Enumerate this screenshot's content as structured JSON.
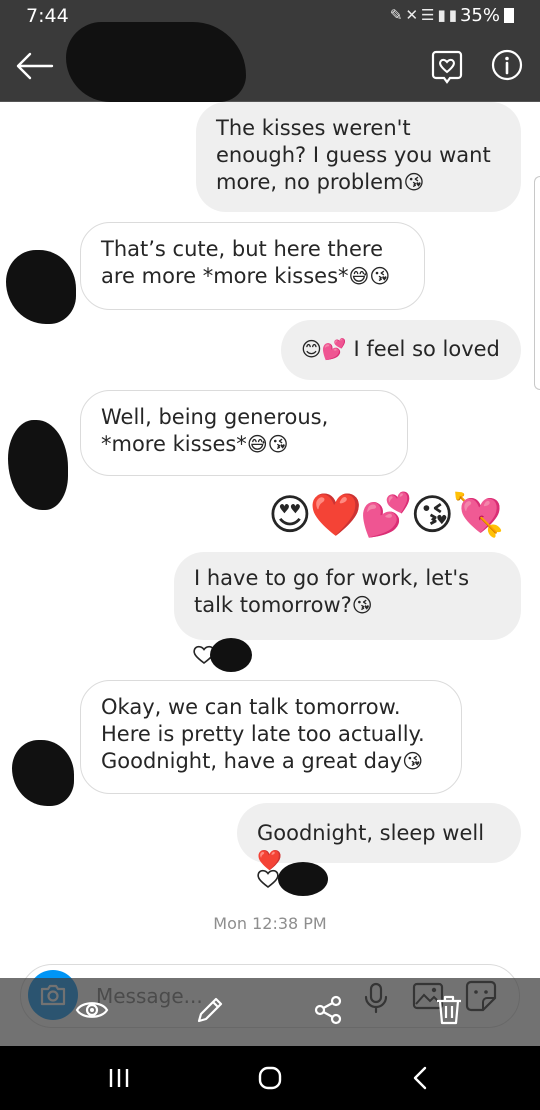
{
  "status_bar": {
    "time": "7:44",
    "battery": "35%"
  },
  "header": {
    "back_icon": "back-arrow-icon",
    "activity_icon": "heart-bubble-icon",
    "info_icon": "info-icon"
  },
  "messages": [
    {
      "direction": "out",
      "text": "The kisses weren't enough? I guess you want more, no problem",
      "emoji": "😘"
    },
    {
      "direction": "in",
      "text": "That’s cute, but here there are more *more kisses*",
      "emoji": "😅😘"
    },
    {
      "direction": "out",
      "prefix_emoji": "😊💕",
      "text": "I feel so loved"
    },
    {
      "direction": "in",
      "text": "Well, being generous, *more kisses*",
      "emoji": "😅😘"
    },
    {
      "direction": "out",
      "emoji_only": "😍❤️💕😘💘"
    },
    {
      "direction": "out",
      "text": "I have to go for work, let's talk tomorrow?",
      "emoji": "😘",
      "reaction": "heart"
    },
    {
      "direction": "in",
      "text": "Okay, we can talk tomorrow. Here is pretty late too actually. Goodnight, have a great day",
      "emoji": "😘"
    },
    {
      "direction": "out",
      "text": "Goodnight, sleep well",
      "emoji": "❤️",
      "reaction": "heart"
    }
  ],
  "timestamp": "Mon 12:38 PM",
  "composer": {
    "placeholder": "Message..."
  },
  "colors": {
    "header_bg": "#3a3a3a",
    "outgoing_bubble": "#efefef",
    "camera_button": "#0095f6",
    "heart_red": "#e0245e"
  }
}
